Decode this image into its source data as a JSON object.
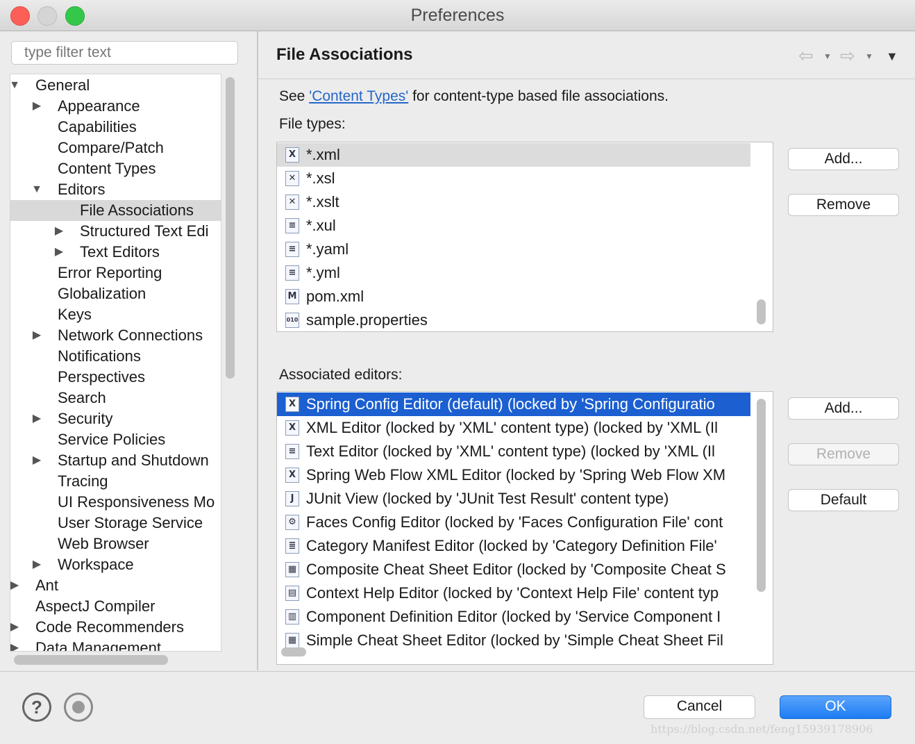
{
  "window": {
    "title": "Preferences"
  },
  "filter": {
    "placeholder": "type filter text"
  },
  "tree": {
    "items": [
      {
        "label": "General",
        "level": 0,
        "toggle": "expanded"
      },
      {
        "label": "Appearance",
        "level": 1,
        "toggle": "collapsed"
      },
      {
        "label": "Capabilities",
        "level": 1,
        "toggle": "none"
      },
      {
        "label": "Compare/Patch",
        "level": 1,
        "toggle": "none"
      },
      {
        "label": "Content Types",
        "level": 1,
        "toggle": "none"
      },
      {
        "label": "Editors",
        "level": 1,
        "toggle": "expanded"
      },
      {
        "label": "File Associations",
        "level": 2,
        "toggle": "none",
        "selected": true
      },
      {
        "label": "Structured Text Edi",
        "level": 2,
        "toggle": "collapsed"
      },
      {
        "label": "Text Editors",
        "level": 2,
        "toggle": "collapsed"
      },
      {
        "label": "Error Reporting",
        "level": 1,
        "toggle": "none"
      },
      {
        "label": "Globalization",
        "level": 1,
        "toggle": "none"
      },
      {
        "label": "Keys",
        "level": 1,
        "toggle": "none"
      },
      {
        "label": "Network Connections",
        "level": 1,
        "toggle": "collapsed"
      },
      {
        "label": "Notifications",
        "level": 1,
        "toggle": "none"
      },
      {
        "label": "Perspectives",
        "level": 1,
        "toggle": "none"
      },
      {
        "label": "Search",
        "level": 1,
        "toggle": "none"
      },
      {
        "label": "Security",
        "level": 1,
        "toggle": "collapsed"
      },
      {
        "label": "Service Policies",
        "level": 1,
        "toggle": "none"
      },
      {
        "label": "Startup and Shutdown",
        "level": 1,
        "toggle": "collapsed"
      },
      {
        "label": "Tracing",
        "level": 1,
        "toggle": "none"
      },
      {
        "label": "UI Responsiveness Mo",
        "level": 1,
        "toggle": "none"
      },
      {
        "label": "User Storage Service",
        "level": 1,
        "toggle": "none"
      },
      {
        "label": "Web Browser",
        "level": 1,
        "toggle": "none"
      },
      {
        "label": "Workspace",
        "level": 1,
        "toggle": "collapsed"
      },
      {
        "label": "Ant",
        "level": 0,
        "toggle": "collapsed"
      },
      {
        "label": "AspectJ Compiler",
        "level": 0,
        "toggle": "none"
      },
      {
        "label": "Code Recommenders",
        "level": 0,
        "toggle": "collapsed"
      },
      {
        "label": "Data Management",
        "level": 0,
        "toggle": "collapsed"
      }
    ]
  },
  "page": {
    "title": "File Associations",
    "see_prefix": "See ",
    "see_link": "'Content Types'",
    "see_suffix": " for content-type based file associations.",
    "file_types_label": "File types:",
    "associated_label": "Associated editors:"
  },
  "file_types": [
    {
      "label": "*.xml",
      "icon": "xml-file-icon",
      "glyph": "X",
      "selected": true
    },
    {
      "label": "*.xsl",
      "icon": "xsl-file-icon",
      "glyph": "✕"
    },
    {
      "label": "*.xslt",
      "icon": "xslt-file-icon",
      "glyph": "✕"
    },
    {
      "label": "*.xul",
      "icon": "text-file-icon",
      "glyph": "≡"
    },
    {
      "label": "*.yaml",
      "icon": "text-file-icon",
      "glyph": "≡"
    },
    {
      "label": "*.yml",
      "icon": "text-file-icon",
      "glyph": "≡"
    },
    {
      "label": "pom.xml",
      "icon": "maven-file-icon",
      "glyph": "M"
    },
    {
      "label": "sample.properties",
      "icon": "properties-file-icon",
      "glyph": "010"
    }
  ],
  "editors": [
    {
      "label": "Spring Config Editor (default) (locked by 'Spring Configuratio",
      "icon": "spring-config-editor-icon",
      "glyph": "X",
      "selected": true
    },
    {
      "label": "XML Editor (locked by 'XML' content type) (locked by 'XML (Il",
      "icon": "xml-editor-icon",
      "glyph": "X"
    },
    {
      "label": "Text Editor (locked by 'XML' content type) (locked by 'XML (Il",
      "icon": "text-editor-icon",
      "glyph": "≡"
    },
    {
      "label": "Spring Web Flow XML Editor (locked by 'Spring Web Flow XM",
      "icon": "spring-web-flow-icon",
      "glyph": "X"
    },
    {
      "label": "JUnit View (locked by 'JUnit Test Result' content type)",
      "icon": "junit-icon",
      "glyph": "J"
    },
    {
      "label": "Faces Config Editor (locked by 'Faces Configuration File' cont",
      "icon": "faces-config-icon",
      "glyph": "⚙"
    },
    {
      "label": "Category Manifest Editor (locked by 'Category Definition File'",
      "icon": "category-manifest-icon",
      "glyph": "≣"
    },
    {
      "label": "Composite Cheat Sheet Editor (locked by 'Composite Cheat S",
      "icon": "cheat-sheet-icon",
      "glyph": "▦"
    },
    {
      "label": "Context Help Editor (locked by 'Context Help File' content typ",
      "icon": "context-help-icon",
      "glyph": "▤"
    },
    {
      "label": "Component Definition Editor (locked by 'Service Component I",
      "icon": "component-definition-icon",
      "glyph": "▥"
    },
    {
      "label": "Simple Cheat Sheet Editor (locked by 'Simple Cheat Sheet Fil",
      "icon": "cheat-sheet-icon",
      "glyph": "▦"
    }
  ],
  "buttons": {
    "add_file": "Add...",
    "remove_file": "Remove",
    "add_editor": "Add...",
    "remove_editor": "Remove",
    "default_editor": "Default",
    "cancel": "Cancel",
    "ok": "OK"
  },
  "bottom": {
    "help_glyph": "?",
    "watermark": "https://blog.csdn.net/feng15939178906"
  },
  "colors": {
    "selection_blue": "#1b5fd1",
    "ok_blue": "#1d7cf2",
    "link": "#2467c9"
  }
}
